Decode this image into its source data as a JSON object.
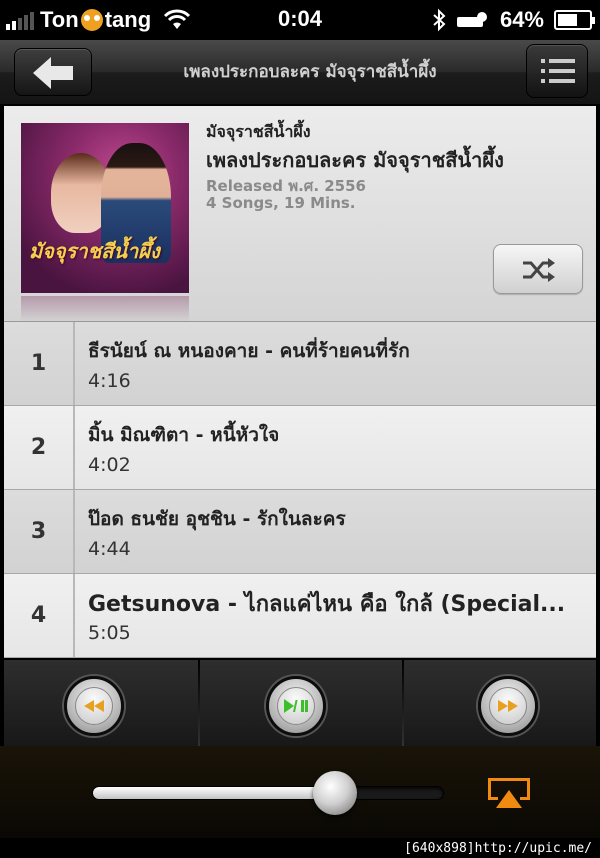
{
  "status_bar": {
    "carrier_left": "Ton",
    "carrier_right": "tang",
    "time": "0:04",
    "battery": "64%",
    "battery_level": 0.64
  },
  "nav": {
    "title": "เพลงประกอบละคร มัจจุราชสีน้ำผึ้ง",
    "back_icon": "back-arrow-icon",
    "menu_icon": "list-menu-icon"
  },
  "album": {
    "artist": "มัจจุราชสีน้ำผึ้ง",
    "title": "เพลงประกอบละคร มัจจุราชสีน้ำผึ้ง",
    "released": "Released พ.ศ. 2556",
    "info": "4 Songs, 19 Mins.",
    "cover_logo": "มัจจุราชสีน้ำผึ้ง",
    "shuffle_icon": "shuffle-icon"
  },
  "tracks": [
    {
      "number": "1",
      "title": "ธีรนัยน์ ณ หนองคาย - คนที่ร้ายคนที่รัก",
      "duration": "4:16"
    },
    {
      "number": "2",
      "title": "มิ้น มิณฑิตา - หนี้หัวใจ",
      "duration": "4:02"
    },
    {
      "number": "3",
      "title": "ป๊อด ธนชัย อุชชิน - รักในละคร",
      "duration": "4:44"
    },
    {
      "number": "4",
      "title": "Getsunova - ไกลแค่ไหน คือ ใกล้ (Special...",
      "duration": "5:05"
    }
  ],
  "controls": {
    "rewind_icon": "rewind-icon",
    "play_pause_icon": "play-pause-icon",
    "forward_icon": "fast-forward-icon",
    "accent_color": "#e8a020",
    "play_color": "#3cbf2a"
  },
  "volume": {
    "level": 0.69,
    "airplay_icon": "airplay-icon",
    "airplay_color": "#f08a10"
  },
  "watermark": "[640x898]http://upic.me/"
}
